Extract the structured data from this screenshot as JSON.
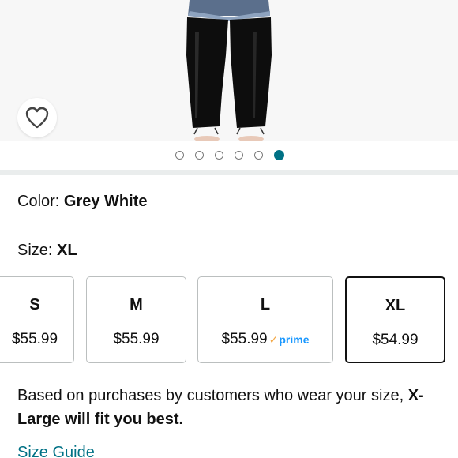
{
  "product_image": {
    "wishlist_icon": "heart-outline-icon",
    "carousel_total": 6,
    "carousel_active_index": 5
  },
  "color": {
    "label": "Color: ",
    "value": "Grey White"
  },
  "size": {
    "label": "Size: ",
    "value": "XL"
  },
  "size_options": [
    {
      "size": "S",
      "price": "$55.99",
      "prime": false,
      "selected": false
    },
    {
      "size": "M",
      "price": "$55.99",
      "prime": false,
      "selected": false
    },
    {
      "size": "L",
      "price": "$55.99",
      "prime": true,
      "selected": false
    },
    {
      "size": "XL",
      "price": "$54.99",
      "prime": false,
      "selected": true
    }
  ],
  "prime_label": "prime",
  "prime_check": "✓",
  "fit_recommendation": {
    "text": "Based on purchases by customers who wear your size, ",
    "emphasis": "X-Large will fit you best."
  },
  "size_guide_link": "Size Guide",
  "colors": {
    "link": "#007185",
    "active_dot": "#007185",
    "prime_blue": "#1a98ff",
    "prime_check": "#f3a847"
  }
}
